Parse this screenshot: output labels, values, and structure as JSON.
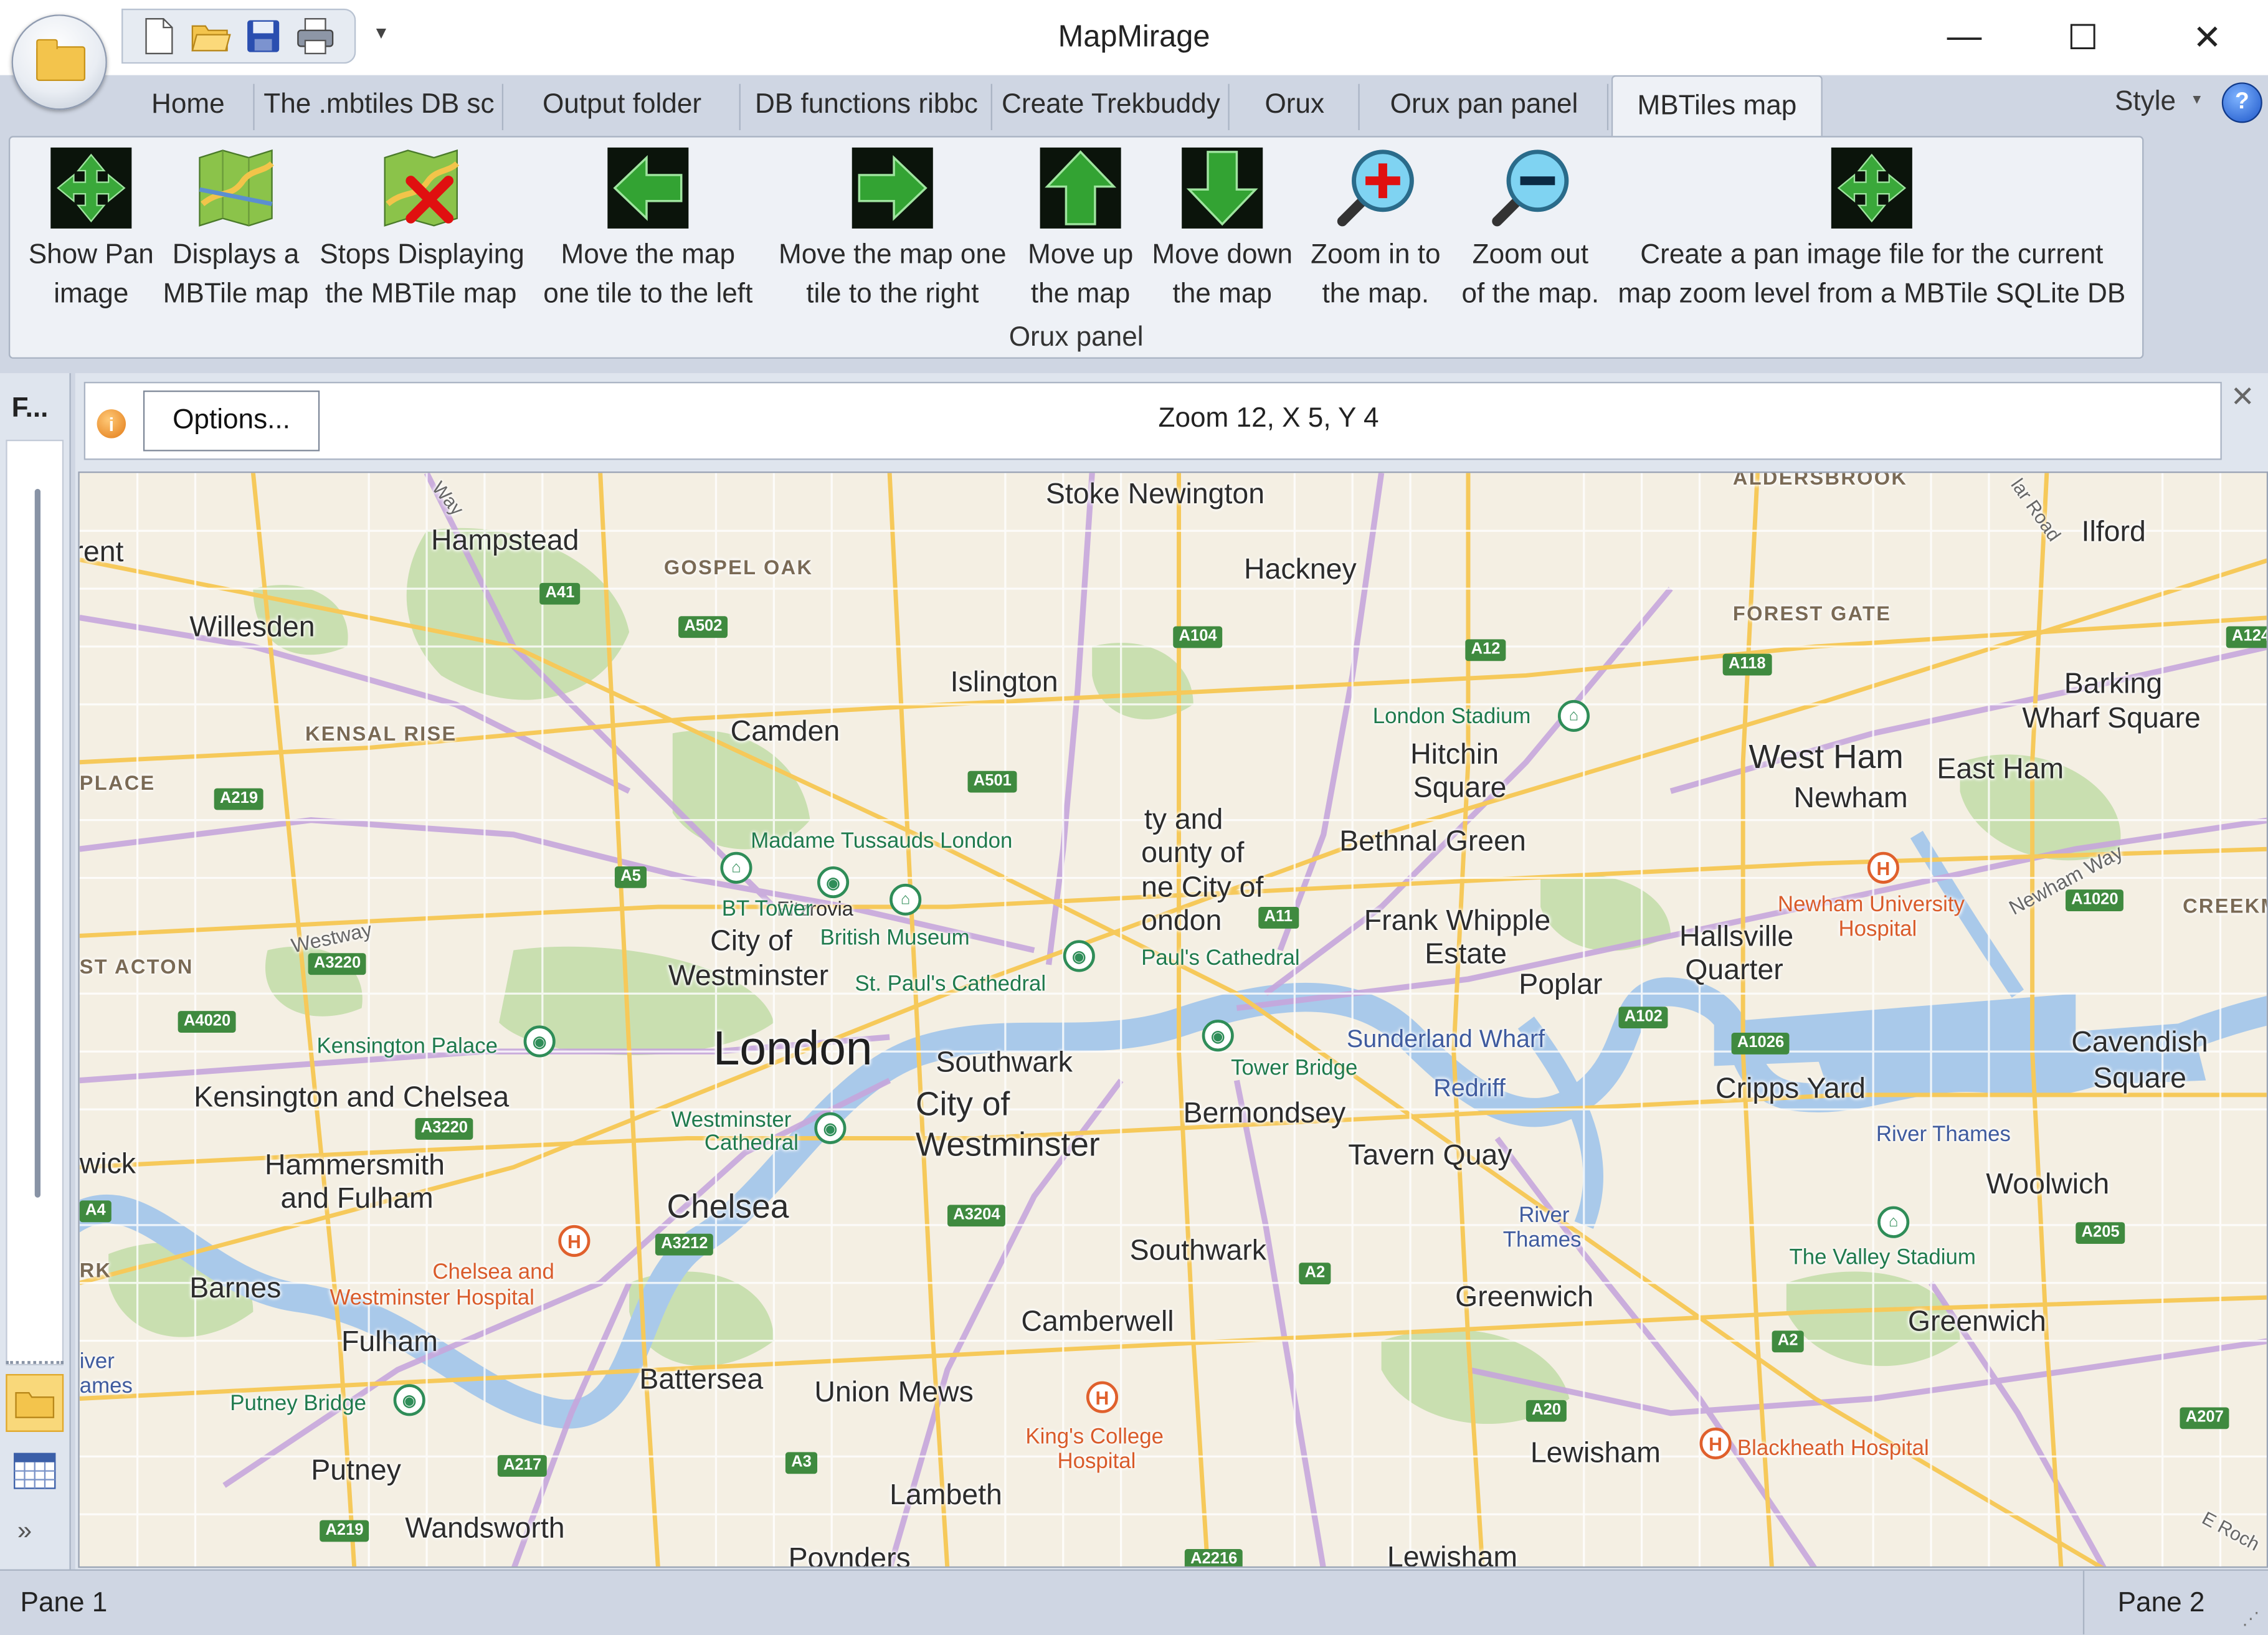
{
  "window": {
    "title": "MapMirage",
    "minimize": "—",
    "maximize": "☐",
    "close": "✕"
  },
  "qat": {
    "customize": "▾"
  },
  "tabs": [
    {
      "label": "Home"
    },
    {
      "label": "The .mbtiles DB sc"
    },
    {
      "label": "Output folder"
    },
    {
      "label": "DB functions ribbc"
    },
    {
      "label": "Create Trekbuddy"
    },
    {
      "label": "Orux"
    },
    {
      "label": "Orux pan panel"
    },
    {
      "label": "MBTiles map"
    }
  ],
  "active_tab": "MBTiles map",
  "style_menu": {
    "label": "Style",
    "arrow": "▾",
    "help": "?"
  },
  "ribbon": {
    "group_label": "Orux panel",
    "buttons": [
      {
        "line1": "Show Pan",
        "line2": "image",
        "icon": "pan-cross-icon"
      },
      {
        "line1": "Displays a",
        "line2": "MBTile map",
        "icon": "map-icon"
      },
      {
        "line1": "Stops Displaying",
        "line2": "the MBTile map",
        "icon": "map-stop-icon"
      },
      {
        "line1": "Move the map",
        "line2": "one tile to the left",
        "icon": "arrow-left-icon"
      },
      {
        "line1": "Move the map one",
        "line2": "tile to the right",
        "icon": "arrow-right-icon"
      },
      {
        "line1": "Move up",
        "line2": "the map",
        "icon": "arrow-up-icon"
      },
      {
        "line1": "Move down",
        "line2": "the map",
        "icon": "arrow-down-icon"
      },
      {
        "line1": "Zoom in to",
        "line2": "the map.",
        "icon": "zoom-in-icon"
      },
      {
        "line1": "Zoom out",
        "line2": "of the map.",
        "icon": "zoom-out-icon"
      },
      {
        "line1": "Create a pan image file for the current",
        "line2": "map zoom level from a MBTile SQLite DB",
        "icon": "pan-cross-icon"
      }
    ]
  },
  "left_pane": {
    "title": "F...",
    "chevron": "»"
  },
  "doc_toolbar": {
    "info": "i",
    "options_label": "Options...",
    "status": "Zoom 12, X 5, Y 4",
    "close": "✕"
  },
  "map": {
    "places_big": [
      {
        "name": "London"
      }
    ],
    "places_med": [
      {
        "name": "Stoke Newington"
      },
      {
        "name": "Hampstead"
      },
      {
        "name": "Hackney"
      },
      {
        "name": "Ilford"
      },
      {
        "name": "Willesden"
      },
      {
        "name": "Islington"
      },
      {
        "name": "Barking"
      },
      {
        "name": "Wharf Square"
      },
      {
        "name": "Camden"
      },
      {
        "name": "Hitchin"
      },
      {
        "name": "Square"
      },
      {
        "name": "West Ham"
      },
      {
        "name": "East Ham"
      },
      {
        "name": "Newham"
      },
      {
        "name": "Bethnal Green"
      },
      {
        "name": "ty and"
      },
      {
        "name": "ounty of"
      },
      {
        "name": "ne City of"
      },
      {
        "name": "ondon"
      },
      {
        "name": "Frank Whipple"
      },
      {
        "name": "Estate"
      },
      {
        "name": "Hallsville"
      },
      {
        "name": "Quarter"
      },
      {
        "name": "Poplar"
      },
      {
        "name": "City of"
      },
      {
        "name": "Westminster"
      },
      {
        "name": "Southwark"
      },
      {
        "name": "City of"
      },
      {
        "name": "Westminster"
      },
      {
        "name": "Kensington and Chelsea"
      },
      {
        "name": "Bermondsey"
      },
      {
        "name": "Cripps Yard"
      },
      {
        "name": "Cavendish"
      },
      {
        "name": "Square"
      },
      {
        "name": "Tavern Quay"
      },
      {
        "name": "Hammersmith"
      },
      {
        "name": "and Fulham"
      },
      {
        "name": "Chelsea"
      },
      {
        "name": "Woolwich"
      },
      {
        "name": "Southwark"
      },
      {
        "name": "Barnes"
      },
      {
        "name": "Greenwich"
      },
      {
        "name": "Camberwell"
      },
      {
        "name": "Greenwich"
      },
      {
        "name": "Fulham"
      },
      {
        "name": "Battersea"
      },
      {
        "name": "Union Mews"
      },
      {
        "name": "Putney"
      },
      {
        "name": "Lambeth"
      },
      {
        "name": "Lewisham"
      },
      {
        "name": "Wandsworth"
      },
      {
        "name": "Poynders"
      },
      {
        "name": "Lewisham"
      },
      {
        "name": "rent"
      },
      {
        "name": "wick"
      },
      {
        "name": "Fitzrovia"
      }
    ],
    "districts": [
      {
        "name": "GOSPEL OAK"
      },
      {
        "name": "FOREST GATE"
      },
      {
        "name": "KENSAL RISE"
      },
      {
        "name": "PLACE"
      },
      {
        "name": "ST ACTON"
      },
      {
        "name": "CREEKM"
      },
      {
        "name": "ALDERSBROOK"
      },
      {
        "name": "RK"
      }
    ],
    "water": [
      {
        "name": "Sunderland Wharf"
      },
      {
        "name": "Redriff"
      },
      {
        "name": "River Thames"
      },
      {
        "name": "River"
      },
      {
        "name": "Thames"
      },
      {
        "name": "iver"
      },
      {
        "name": "ames"
      }
    ],
    "pois": [
      {
        "name": "London Stadium"
      },
      {
        "name": "Madame Tussauds London"
      },
      {
        "name": "BT Tower"
      },
      {
        "name": "British Museum"
      },
      {
        "name": "St. Paul's Cathedral"
      },
      {
        "name": "Paul's Cathedral"
      },
      {
        "name": "Kensington Palace"
      },
      {
        "name": "Tower Bridge"
      },
      {
        "name": "Westminster"
      },
      {
        "name": "Cathedral"
      },
      {
        "name": "Putney Bridge"
      },
      {
        "name": "The Valley Stadium"
      }
    ],
    "hospitals": [
      {
        "name": "Newham University"
      },
      {
        "name": "Hospital"
      },
      {
        "name": "Chelsea and"
      },
      {
        "name": "Westminster Hospital"
      },
      {
        "name": "King's College"
      },
      {
        "name": "Hospital"
      },
      {
        "name": "Blackheath Hospital"
      }
    ],
    "roads": [
      {
        "name": "A41"
      },
      {
        "name": "A502"
      },
      {
        "name": "A104"
      },
      {
        "name": "A12"
      },
      {
        "name": "A118"
      },
      {
        "name": "A124"
      },
      {
        "name": "A501"
      },
      {
        "name": "A219"
      },
      {
        "name": "A5"
      },
      {
        "name": "A3220"
      },
      {
        "name": "A11"
      },
      {
        "name": "A4020"
      },
      {
        "name": "A102"
      },
      {
        "name": "A1026"
      },
      {
        "name": "A1020"
      },
      {
        "name": "A3220"
      },
      {
        "name": "A4"
      },
      {
        "name": "A3212"
      },
      {
        "name": "A3204"
      },
      {
        "name": "A2"
      },
      {
        "name": "A205"
      },
      {
        "name": "A20"
      },
      {
        "name": "A2"
      },
      {
        "name": "A207"
      },
      {
        "name": "A217"
      },
      {
        "name": "A3"
      },
      {
        "name": "A219"
      },
      {
        "name": "A2216"
      }
    ],
    "street_names": [
      {
        "name": "Way"
      },
      {
        "name": "Westway"
      },
      {
        "name": "Newham Way"
      },
      {
        "name": "lar Road"
      },
      {
        "name": "E Roch"
      }
    ],
    "colors": {
      "land": "#f4efe3",
      "water": "#a9c9ea",
      "park": "#c9dfb0",
      "road_major": "#f6c95a",
      "road_primary": "#c6a6dc",
      "road_label": "#3f8a3f"
    }
  },
  "statusbar": {
    "pane1": "Pane 1",
    "pane2": "Pane 2",
    "grip": "⋰"
  }
}
